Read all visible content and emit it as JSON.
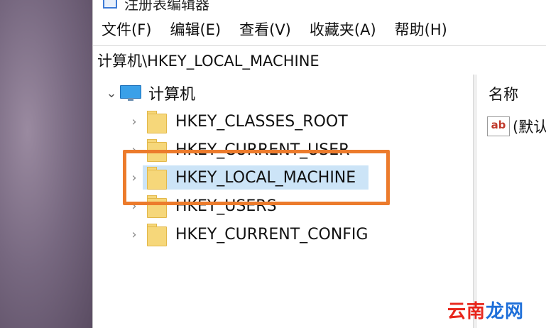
{
  "window": {
    "title": "注册表编辑器"
  },
  "menu": [
    "文件(F)",
    "编辑(E)",
    "查看(V)",
    "收藏夹(A)",
    "帮助(H)"
  ],
  "address": "计算机\\HKEY_LOCAL_MACHINE",
  "tree": {
    "root": {
      "label": "计算机",
      "expander": "⌄"
    },
    "keys": [
      {
        "label": "HKEY_CLASSES_ROOT",
        "expander": "›"
      },
      {
        "label": "HKEY_CURRENT_USER",
        "expander": "›"
      },
      {
        "label": "HKEY_LOCAL_MACHINE",
        "expander": "›",
        "selected": true
      },
      {
        "label": "HKEY_USERS",
        "expander": "›"
      },
      {
        "label": "HKEY_CURRENT_CONFIG",
        "expander": "›"
      }
    ]
  },
  "values_pane": {
    "column_name": "名称",
    "rows": [
      {
        "icon": "ab",
        "name": "(默认"
      }
    ]
  },
  "watermark": {
    "part1": "云南",
    "part2": "龙网"
  },
  "colors": {
    "highlight": "#ec7b2c",
    "selection": "#cce4f7",
    "folder": "#f6d77a"
  }
}
